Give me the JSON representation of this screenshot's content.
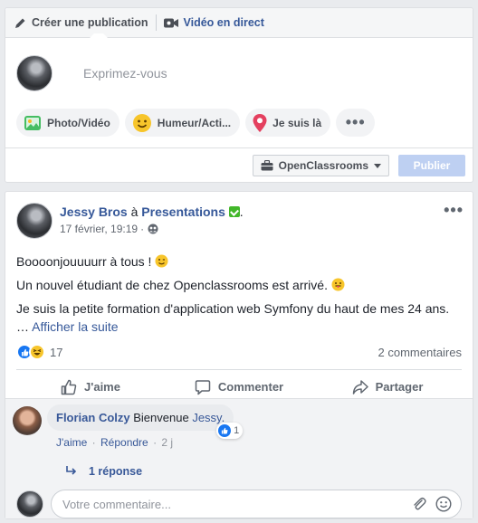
{
  "composer": {
    "tab_create": "Créer une publication",
    "tab_live": "Vidéo en direct",
    "placeholder": "Exprimez-vous",
    "pills": {
      "photo": "Photo/Vidéo",
      "mood": "Humeur/Acti...",
      "location": "Je suis là",
      "more": "•••"
    },
    "page_select": "OpenClassrooms",
    "publish": "Publier"
  },
  "post": {
    "author": "Jessy Bros",
    "at": "à",
    "page": "Presentations",
    "time": "17 février, 19:19",
    "separator": "·",
    "menu": "•••",
    "line1": "Boooonjouuuurr à tous !",
    "line2": "Un nouvel étudiant de chez Openclassrooms est arrivé.",
    "line3": "Je suis la petite formation d'application web Symfony du haut de mes 24 ans.",
    "ellipsis": "…",
    "see_more": "Afficher la suite",
    "reaction_count": "17",
    "comments_count": "2 commentaires",
    "actions": {
      "like": "J'aime",
      "comment": "Commenter",
      "share": "Partager"
    }
  },
  "comment": {
    "author": "Florian Colzy",
    "text": "Bienvenue",
    "mention": "Jessy.",
    "reaction_count": "1",
    "like": "J'aime",
    "reply": "Répondre",
    "time": "2 j",
    "dot": "·",
    "replies": "1 réponse"
  },
  "write_comment": {
    "placeholder": "Votre commentaire..."
  },
  "colors": {
    "link": "#365899",
    "like_blue": "#1877f2",
    "publish_disabled": "#bed0f2"
  }
}
